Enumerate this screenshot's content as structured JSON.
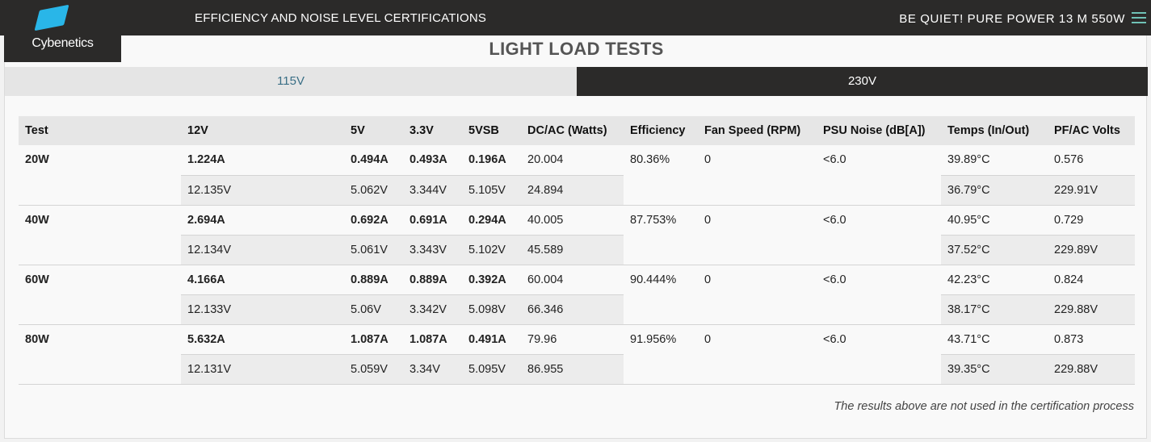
{
  "header": {
    "logo_text": "Cybenetics",
    "title": "EFFICIENCY AND NOISE LEVEL CERTIFICATIONS",
    "product": "BE QUIET! PURE POWER 13 M 550W",
    "menu_icon": "hamburger-menu-icon",
    "colors": {
      "bar": "#2b2a29",
      "logo_accent": "#29b6e8",
      "menu_icon": "#6fc2b6"
    }
  },
  "section": {
    "title": "LIGHT LOAD TESTS"
  },
  "tabs": [
    {
      "label": "115V",
      "active": true
    },
    {
      "label": "230V",
      "active": false
    }
  ],
  "table": {
    "headers": [
      "Test",
      "12V",
      "5V",
      "3.3V",
      "5VSB",
      "DC/AC (Watts)",
      "Efficiency",
      "Fan Speed (RPM)",
      "PSU Noise (dB[A])",
      "Temps (In/Out)",
      "PF/AC Volts"
    ],
    "rows": [
      {
        "test": "20W",
        "amps": [
          "1.224A",
          "0.494A",
          "0.493A",
          "0.196A",
          "20.004"
        ],
        "volts": [
          "12.135V",
          "5.062V",
          "3.344V",
          "5.105V",
          "24.894"
        ],
        "efficiency": "80.36%",
        "fan": "0",
        "noise": "<6.0",
        "temp_in": "39.89°C",
        "temp_out": "36.79°C",
        "pf": "0.576",
        "ac_volts": "229.91V"
      },
      {
        "test": "40W",
        "amps": [
          "2.694A",
          "0.692A",
          "0.691A",
          "0.294A",
          "40.005"
        ],
        "volts": [
          "12.134V",
          "5.061V",
          "3.343V",
          "5.102V",
          "45.589"
        ],
        "efficiency": "87.753%",
        "fan": "0",
        "noise": "<6.0",
        "temp_in": "40.95°C",
        "temp_out": "37.52°C",
        "pf": "0.729",
        "ac_volts": "229.89V"
      },
      {
        "test": "60W",
        "amps": [
          "4.166A",
          "0.889A",
          "0.889A",
          "0.392A",
          "60.004"
        ],
        "volts": [
          "12.133V",
          "5.06V",
          "3.342V",
          "5.098V",
          "66.346"
        ],
        "efficiency": "90.444%",
        "fan": "0",
        "noise": "<6.0",
        "temp_in": "42.23°C",
        "temp_out": "38.17°C",
        "pf": "0.824",
        "ac_volts": "229.88V"
      },
      {
        "test": "80W",
        "amps": [
          "5.632A",
          "1.087A",
          "1.087A",
          "0.491A",
          "79.96"
        ],
        "volts": [
          "12.131V",
          "5.059V",
          "3.34V",
          "5.095V",
          "86.955"
        ],
        "efficiency": "91.956%",
        "fan": "0",
        "noise": "<6.0",
        "temp_in": "43.71°C",
        "temp_out": "39.35°C",
        "pf": "0.873",
        "ac_volts": "229.88V"
      }
    ]
  },
  "note": "The results above are not used in the certification process"
}
